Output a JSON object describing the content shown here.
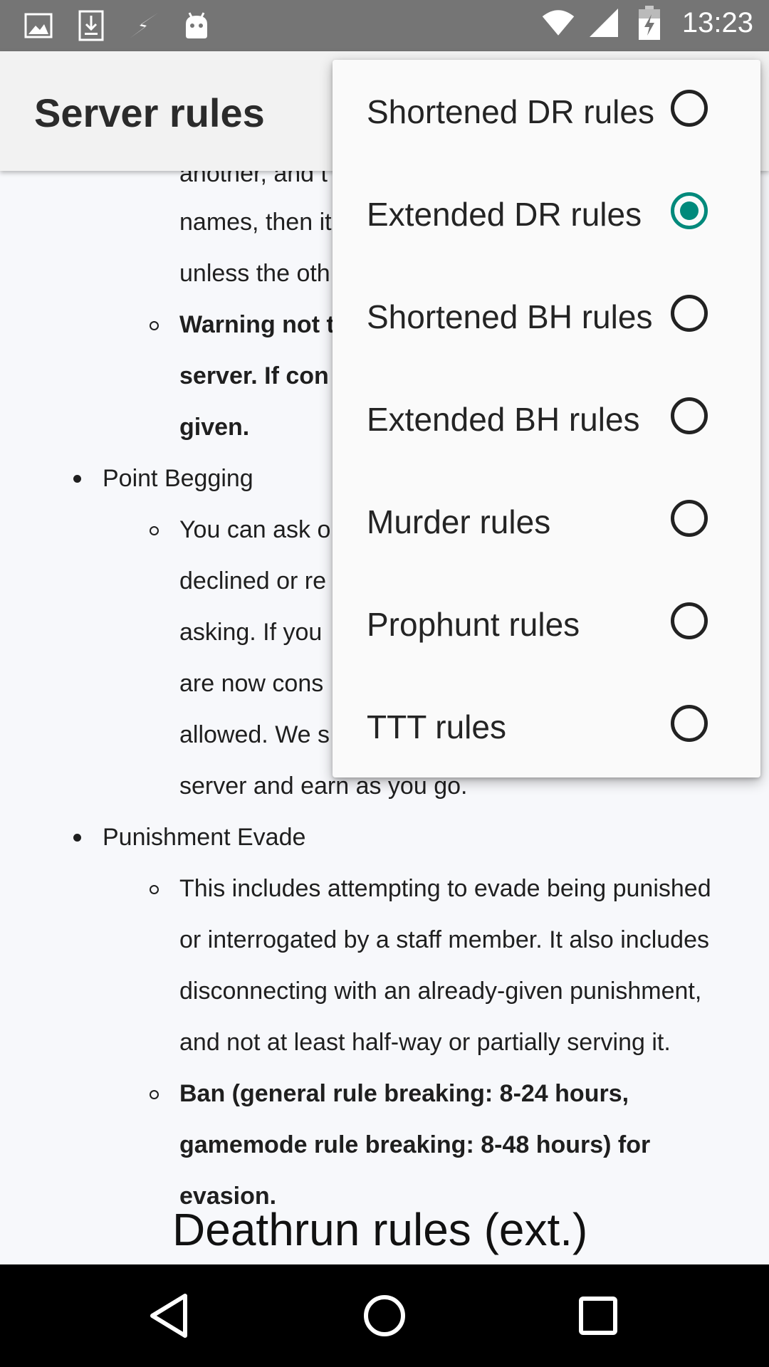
{
  "status_bar": {
    "time": "13:23",
    "left_icons": [
      "image-icon",
      "download-icon",
      "flash-icon",
      "android-icon"
    ],
    "right_icons": [
      "wifi-icon",
      "signal-icon",
      "battery-charging-icon"
    ]
  },
  "app_bar": {
    "title": "Server rules"
  },
  "content": {
    "lines": [
      "another, and t",
      "names, then it",
      "unless the oth",
      "Warning not t",
      "server. If con",
      "given.",
      "Point Begging",
      "You can ask o",
      "declined or re",
      "asking. If you",
      "are now cons",
      "allowed. We s",
      "server and earn as you go.",
      "Punishment Evade",
      "This includes attempting to evade being punished",
      "or interrogated by a staff member. It also includes",
      "disconnecting with an already-given punishment,",
      "and not at least half-way or partially serving it.",
      "Ban (general rule breaking: 8-24 hours,",
      "gamemode rule breaking: 8-48 hours) for",
      "evasion."
    ],
    "section_title": "Deathrun rules (ext.)"
  },
  "menu": {
    "items": [
      {
        "label": "Shortened DR rules",
        "checked": false
      },
      {
        "label": "Extended DR rules",
        "checked": true
      },
      {
        "label": "Shortened BH rules",
        "checked": false
      },
      {
        "label": "Extended BH rules",
        "checked": false
      },
      {
        "label": "Murder rules",
        "checked": false
      },
      {
        "label": "Prophunt rules",
        "checked": false
      },
      {
        "label": "TTT rules",
        "checked": false
      }
    ]
  },
  "colors": {
    "accent": "#00897b",
    "status_bar": "#757575",
    "app_bar": "#f2f2f2",
    "nav_bar": "#000000"
  }
}
